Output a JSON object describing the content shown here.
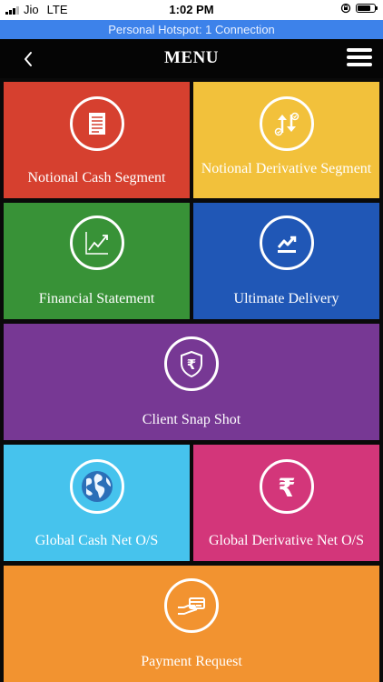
{
  "status": {
    "carrier": "Jio",
    "network": "LTE",
    "time": "1:02 PM"
  },
  "hotspot": {
    "text": "Personal Hotspot: 1 Connection"
  },
  "nav": {
    "title": "MENU"
  },
  "tiles": [
    {
      "label": "Notional Cash Segment",
      "color": "#d6402f",
      "icon": "document-icon"
    },
    {
      "label": "Notional Derivative Segment",
      "color": "#f2c13b",
      "icon": "updown-arrows-icon"
    },
    {
      "label": "Financial Statement",
      "color": "#389237",
      "icon": "line-chart-icon"
    },
    {
      "label": "Ultimate Delivery",
      "color": "#2057b6",
      "icon": "trend-icon"
    },
    {
      "label": "Client Snap Shot",
      "color": "#773894",
      "icon": "rupee-shield-icon"
    },
    {
      "label": "Global Cash Net O/S",
      "color": "#46c3ed",
      "icon": "globe-icon"
    },
    {
      "label": "Global Derivative Net O/S",
      "color": "#d3367a",
      "icon": "rupee-icon"
    },
    {
      "label": "Payment Request",
      "color": "#f29330",
      "icon": "hand-card-icon"
    }
  ]
}
